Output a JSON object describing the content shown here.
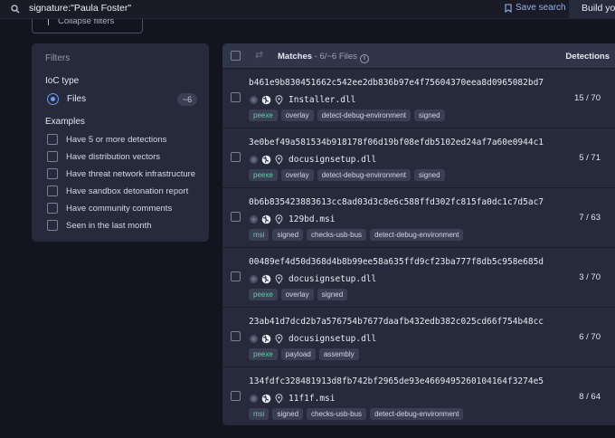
{
  "search": {
    "query": "signature:\"Paula Foster\"",
    "save_label": "Save search",
    "build_label": "Build your"
  },
  "collapse_filters_label": "Collapse filters",
  "filters": {
    "title": "Filters",
    "ioc_type_label": "IoC type",
    "ioc_option": {
      "label": "Files",
      "count": "~6",
      "selected": true
    },
    "examples_label": "Examples",
    "examples": [
      "Have 5 or more detections",
      "Have distribution vectors",
      "Have threat network infrastructure",
      "Have sandbox detonation report",
      "Have community comments",
      "Seen in the last month"
    ]
  },
  "results": {
    "matches_label": "Matches",
    "matches_count": "- 6/~6 Files",
    "detections_label": "Detections",
    "rows": [
      {
        "hash": "b461e9b830451662c542ee2db836b97e4f75604370eea8d0965082bd7",
        "file": "Installer.dll",
        "tags": [
          "peexe",
          "overlay",
          "detect-debug-environment",
          "signed"
        ],
        "detections": "15 / 70"
      },
      {
        "hash": "3e0bef49a581534b918178f06d19bf08efdb5102ed24af7a60e0944c1",
        "file": "docusignsetup.dll",
        "tags": [
          "peexe",
          "overlay",
          "detect-debug-environment",
          "signed"
        ],
        "detections": "5 / 71"
      },
      {
        "hash": "0b6b835423883613cc8ad03d3c8e6c588ffd302fc815fa0dc1c7d5ac7",
        "file": "129bd.msi",
        "tags": [
          "msi",
          "signed",
          "checks-usb-bus",
          "detect-debug-environment"
        ],
        "detections": "7 / 63"
      },
      {
        "hash": "00489ef4d50d368d4b8b99ee58a635ffd9cf23ba777f8db5c958e685d",
        "file": "docusignsetup.dll",
        "tags": [
          "peexe",
          "overlay",
          "signed"
        ],
        "detections": "3 / 70"
      },
      {
        "hash": "23ab41d7dcd2b7a576754b7677daafb432edb382c025cd66f754b48cc",
        "file": "docusignsetup.dll",
        "tags": [
          "peexe",
          "payload",
          "assembly"
        ],
        "detections": "6 / 70"
      },
      {
        "hash": "134fdfc328481913d8fb742bf2965de93e4669495260104164f3274e5",
        "file": "11f1f.msi",
        "tags": [
          "msi",
          "signed",
          "checks-usb-bus",
          "detect-debug-environment"
        ],
        "detections": "8 / 64"
      }
    ]
  },
  "icons": {
    "search": "search-icon",
    "bookmark": "bookmark-icon",
    "info": "info-icon",
    "swap": "swap-icon",
    "status": "status-dot-icon",
    "globe": "globe-icon",
    "location": "location-pin-icon"
  },
  "colors": {
    "accent_blue": "#6f9cf0",
    "tag_green": "#5fd1a6",
    "panel_bg": "#262a3a",
    "page_bg": "#13141f"
  }
}
